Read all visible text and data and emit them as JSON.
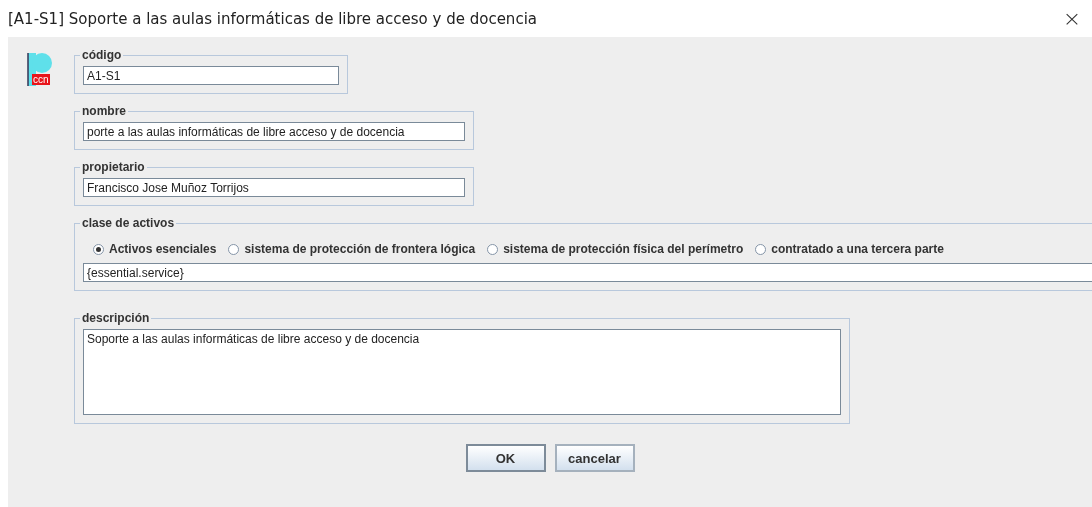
{
  "window": {
    "title": "[A1-S1] Soporte a las aulas informáticas de libre acceso y de docencia",
    "close": "×"
  },
  "logo": {
    "text": "ccn"
  },
  "codigo": {
    "legend": "código",
    "value": "A1-S1"
  },
  "nombre": {
    "legend": "nombre",
    "value": "porte a las aulas informáticas de libre acceso y de docencia"
  },
  "propietario": {
    "legend": "propietario",
    "value": "Francisco Jose Muñoz Torrijos"
  },
  "clase": {
    "legend": "clase de activos",
    "options": [
      {
        "label": "Activos esenciales",
        "selected": true
      },
      {
        "label": "sistema de protección de frontera lógica",
        "selected": false
      },
      {
        "label": "sistema de protección física del perímetro",
        "selected": false
      },
      {
        "label": "contratado a una tercera parte",
        "selected": false
      }
    ],
    "value": "{essential.service}"
  },
  "descripcion": {
    "legend": "descripción",
    "value": "Soporte a las aulas informáticas de libre acceso y de docencia"
  },
  "buttons": [
    {
      "label": "OK",
      "focused": true
    },
    {
      "label": "cancelar",
      "focused": false
    }
  ]
}
